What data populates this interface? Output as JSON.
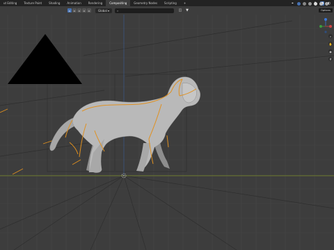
{
  "workspace_tabs": [
    "ut Editing",
    "Texture Paint",
    "Shading",
    "Animation",
    "Rendering",
    "Compositing",
    "Geometry Nodes",
    "Scripting",
    "+"
  ],
  "active_tab_index": 5,
  "header": {
    "view_dropdown": "Global",
    "search_placeholder": "",
    "tooltip": "Options"
  },
  "icons": {
    "snap": "magnet-icon",
    "proportional": "proportional-edit-icon",
    "shading": "viewport-shading-icon",
    "gizmo": "navigation-gizmo-icon",
    "zoom": "zoom-icon",
    "pan": "hand-icon",
    "camera": "camera-icon",
    "ortho": "grid-icon",
    "camera_object": "camera-triangle-icon",
    "origin": "object-origin-icon"
  },
  "colors": {
    "background": "#3d3d3d",
    "grid_line": "#474747",
    "horizon_line": "#7f8f2a",
    "selection_outline": "#e0901f",
    "accent": "#4772b3"
  }
}
